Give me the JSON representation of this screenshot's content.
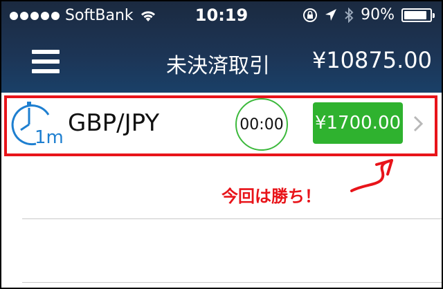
{
  "status_bar": {
    "signal_dots": 5,
    "carrier": "SoftBank",
    "time": "10:19",
    "battery_text": "90%",
    "battery_level": 0.9,
    "icons": [
      "wifi-icon",
      "rotation-lock-icon",
      "location-arrow-icon",
      "bluetooth-icon",
      "battery-icon"
    ]
  },
  "nav": {
    "title": "未決済取引",
    "balance": "¥10875.00"
  },
  "trade": {
    "pair": "GBP/JPY",
    "timer_label": "1m",
    "countdown": "00:00",
    "payout": "¥1700.00"
  },
  "annotation": {
    "text": "今回は勝ち！"
  },
  "colors": {
    "header_top": "#1b2a40",
    "header_bottom": "#1a4068",
    "highlight": "#e8141a",
    "payout_green": "#2fb22f",
    "countdown_ring": "#3cb93c",
    "timer_blue": "#1e7fd0"
  }
}
